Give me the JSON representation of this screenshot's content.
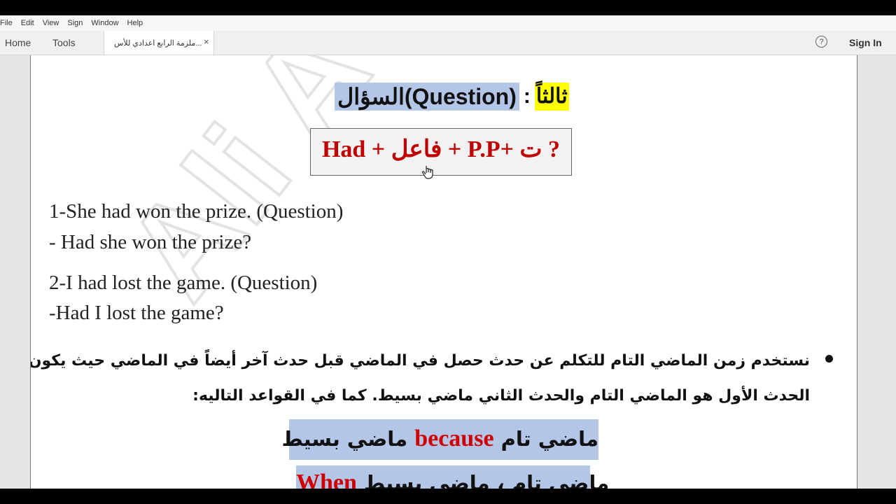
{
  "menu": [
    "File",
    "Edit",
    "View",
    "Sign",
    "Window",
    "Help"
  ],
  "nav": {
    "home": "Home",
    "tools": "Tools"
  },
  "tab": {
    "title": "ملزمة الرابع اعدادي للأس...",
    "close": "×"
  },
  "header": {
    "help": "?",
    "sign_in": "Sign In"
  },
  "document": {
    "heading_label": "ثالثاً",
    "heading_colon": ":",
    "heading_text": "السؤال(Question)",
    "formula": "Had + فاعل + P.P+ ت ?",
    "watermark": "Ali A",
    "examples": [
      "1-She had won the prize. (Question)",
      "- Had she won the prize?",
      "2-I had lost the game. (Question)",
      "-Had I lost the game?"
    ],
    "note_line1": "نستخدم زمن الماضي التام للتكلم عن حدث حصل في الماضي قبل حدث آخر أيضاً في الماضي حيث يكون",
    "note_line2": "الحدث الأول هو الماضي التام والحدث الثاني ماضي بسيط. كما في القواعد التاليه:",
    "rule1": {
      "left": "ماضي تام",
      "keyword": "because",
      "right": "ماضي بسيط"
    },
    "rule2": {
      "keyword": "When",
      "text": "ماضي تام ، ماضي بسيط"
    }
  }
}
